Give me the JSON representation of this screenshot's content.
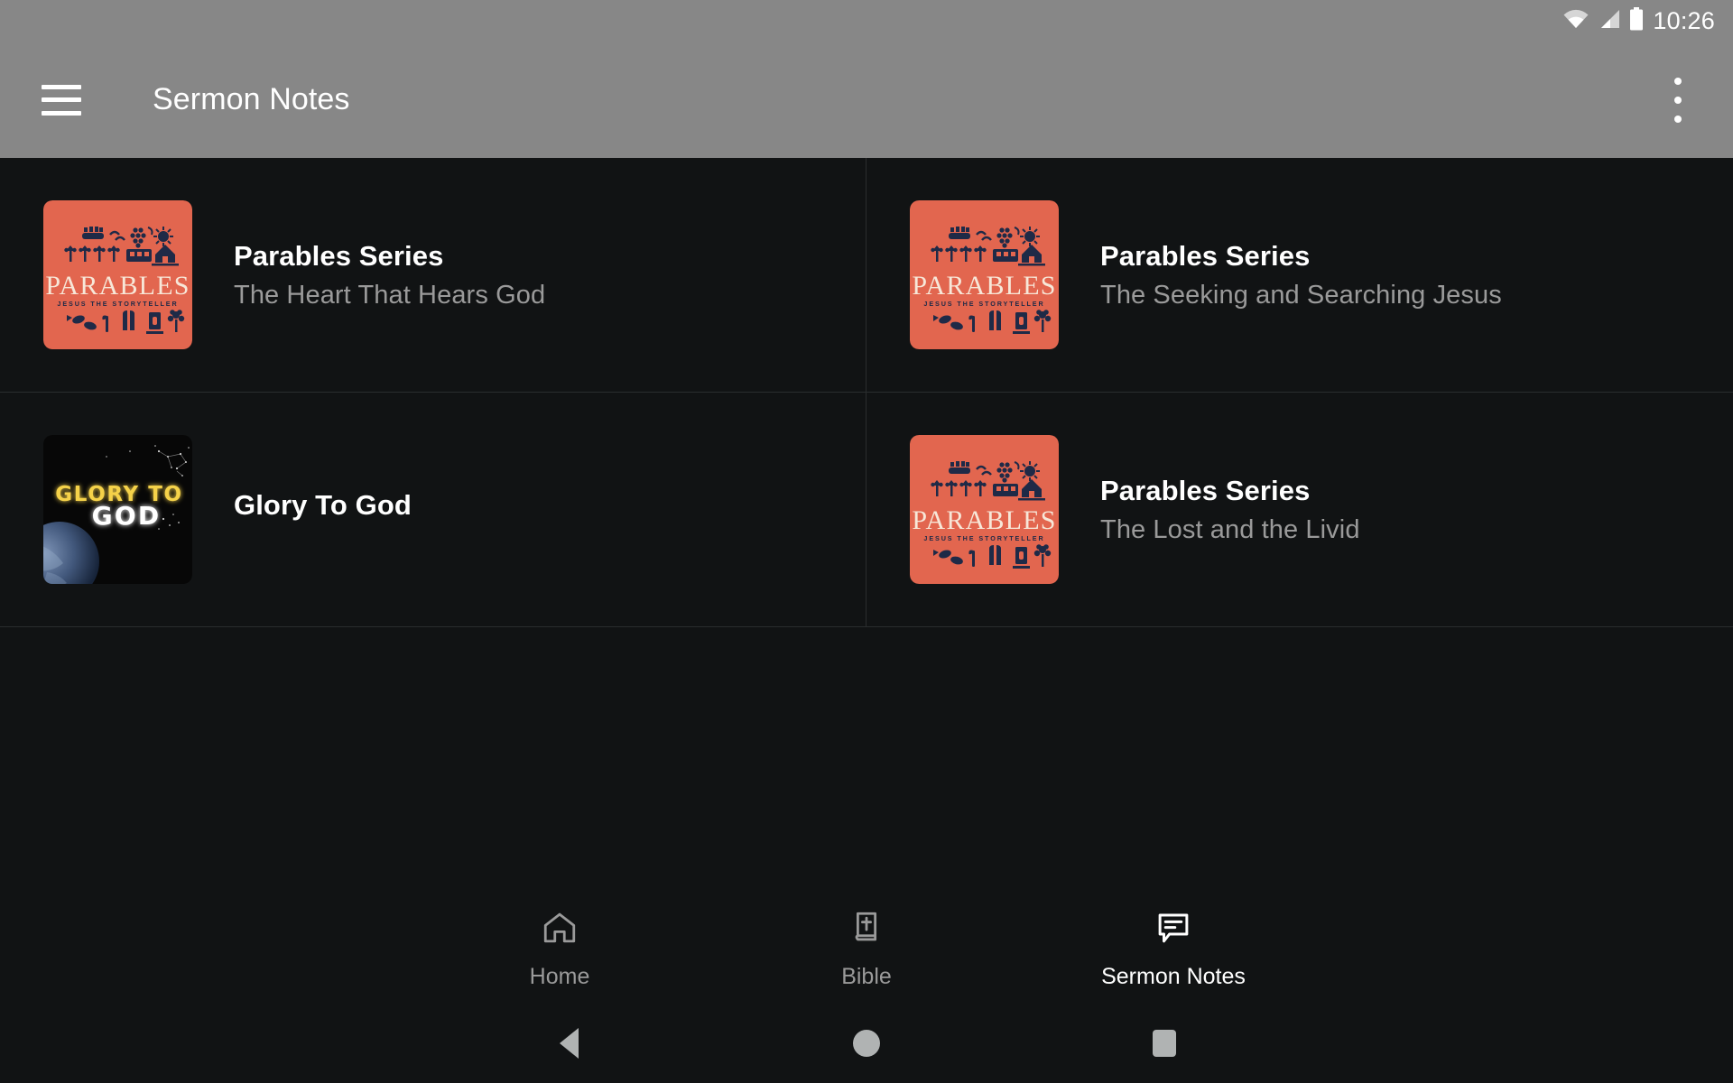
{
  "status_bar": {
    "time": "10:26",
    "icons": [
      "wifi-icon",
      "cellular-signal-icon",
      "battery-icon"
    ]
  },
  "app_bar": {
    "menu_icon": "hamburger-menu-icon",
    "title": "Sermon Notes",
    "overflow_icon": "overflow-menu-icon",
    "background_color": "#878787"
  },
  "theme": {
    "page_background": "#111314",
    "divider": "#2a2d2e",
    "title_text": "#ffffff",
    "subtitle_text": "#9a9a9a",
    "parables_accent": "#E2664F",
    "parables_ink": "#1F2A47",
    "parables_cream": "#F7E7D8",
    "glory_yellow": "#F5D24A"
  },
  "sermon_list": [
    {
      "title": "Parables Series",
      "subtitle": "The Heart That Hears God",
      "thumbnail": "parables-series-artwork",
      "artwork_text": {
        "main": "PARABLES",
        "sub": "JESUS THE STORYTELLER"
      }
    },
    {
      "title": "Parables Series",
      "subtitle": "The Seeking and Searching Jesus",
      "thumbnail": "parables-series-artwork",
      "artwork_text": {
        "main": "PARABLES",
        "sub": "JESUS THE STORYTELLER"
      }
    },
    {
      "title": "Glory To God",
      "subtitle": "",
      "thumbnail": "glory-to-god-artwork",
      "artwork_text": {
        "main": "GLORY TO",
        "sub": "GOD"
      }
    },
    {
      "title": "Parables Series",
      "subtitle": "The Lost and the Livid",
      "thumbnail": "parables-series-artwork",
      "artwork_text": {
        "main": "PARABLES",
        "sub": "JESUS THE STORYTELLER"
      }
    }
  ],
  "bottom_nav": {
    "items": [
      {
        "label": "Home",
        "icon": "home-icon",
        "active": false
      },
      {
        "label": "Bible",
        "icon": "bible-book-icon",
        "active": false
      },
      {
        "label": "Sermon Notes",
        "icon": "speech-bubble-notes-icon",
        "active": true
      }
    ]
  },
  "system_nav": {
    "back": "back-triangle-icon",
    "home": "home-circle-icon",
    "recents": "recents-square-icon"
  }
}
